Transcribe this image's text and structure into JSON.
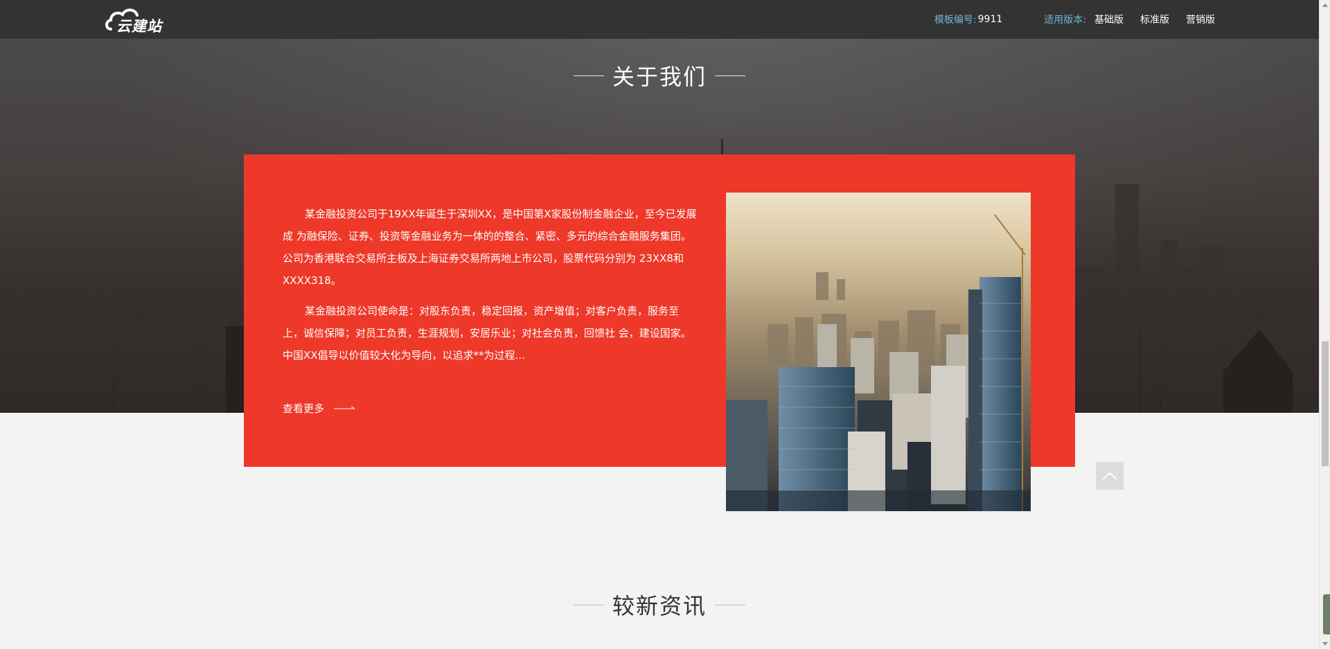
{
  "header": {
    "logo_text": "云建站",
    "template_label": "模板编号:",
    "template_number": "9911",
    "version_label": "适用版本:",
    "versions": [
      "基础版",
      "标准版",
      "营销版"
    ]
  },
  "about": {
    "title": "关于我们",
    "paragraphs": [
      "某金融投资公司于19XX年诞生于深圳XX，是中国第X家股份制金融企业，至今已发展成 为融保险、证券、投资等金融业务为一体的的整合、紧密、多元的综合金融服务集团。公司为香港联合交易所主板及上海证券交易所两地上市公司，股票代码分别为 23XX8和XXXX318。",
      "某金融投资公司使命是：对股东负责，稳定回报，资产增值；对客户负责，服务至上，诚信保障；对员工负责，生涯规划，安居乐业；对社会负责，回馈社 会，建设国家。中国XX倡导以价值较大化为导向，以追求**为过程..."
    ],
    "more_label": "查看更多"
  },
  "news": {
    "title": "较新资讯"
  },
  "colors": {
    "topbar_bg": "#333333",
    "accent_red": "#ee3829",
    "label_blue": "#6fb3d8",
    "page_bg": "#f3f3f3"
  },
  "icons": {
    "logo": "cloud-icon",
    "more": "long-arrow-right-icon",
    "back_to_top": "chevron-up-icon"
  }
}
